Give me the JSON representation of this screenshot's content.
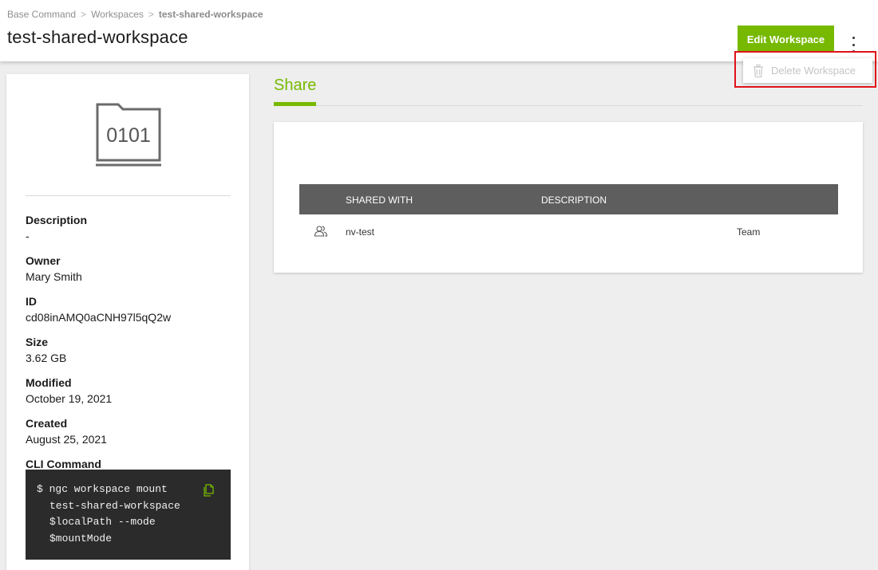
{
  "breadcrumb": {
    "items": [
      "Base Command",
      "Workspaces"
    ],
    "current": "test-shared-workspace"
  },
  "page": {
    "title": "test-shared-workspace"
  },
  "actions": {
    "edit_label": "Edit Workspace",
    "menu_icon": "more-vertical-icon",
    "menu_items": [
      {
        "label": "Delete Workspace",
        "icon": "trash-icon",
        "disabled": true
      }
    ]
  },
  "workspace": {
    "icon_text": "0101",
    "fields": [
      {
        "label": "Description",
        "value": "-"
      },
      {
        "label": "Owner",
        "value": "Mary Smith"
      },
      {
        "label": "ID",
        "value": "cd08inAMQ0aCNH97l5qQ2w"
      },
      {
        "label": "Size",
        "value": "3.62 GB"
      },
      {
        "label": "Modified",
        "value": "October 19, 2021"
      },
      {
        "label": "Created",
        "value": "August 25, 2021"
      }
    ],
    "cli_label": "CLI Command",
    "cli_lines": [
      "$ ngc workspace mount",
      "test-shared-workspace",
      "$localPath --mode",
      "$mountMode"
    ]
  },
  "share": {
    "tab_label": "Share",
    "columns": [
      "SHARED WITH",
      "DESCRIPTION"
    ],
    "rows": [
      {
        "icon": "group-icon",
        "shared_with": "nv-test",
        "description": "",
        "type": "Team"
      }
    ]
  },
  "colors": {
    "accent": "#76b900",
    "table_header": "#5e5e5e",
    "highlight": "#e0121a"
  }
}
